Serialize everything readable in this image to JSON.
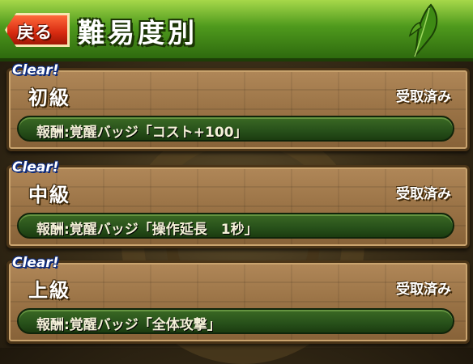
{
  "header": {
    "back_label": "戻る",
    "title": "難易度別"
  },
  "levels": [
    {
      "badge": "Clear!",
      "name": "初級",
      "status": "受取済み",
      "reward": "報酬:覚醒バッジ「コスト+100」"
    },
    {
      "badge": "Clear!",
      "name": "中級",
      "status": "受取済み",
      "reward": "報酬:覚醒バッジ「操作延長　1秒」"
    },
    {
      "badge": "Clear!",
      "name": "上級",
      "status": "受取済み",
      "reward": "報酬:覚醒バッジ「全体攻撃」"
    }
  ],
  "colors": {
    "header_green": "#4f9a1d",
    "back_red": "#d72a10",
    "panel_brown": "#9a7346",
    "reward_green": "#27501a",
    "clear_blue": "#0d2a7a"
  },
  "icons": {
    "back": "back-arrow-icon",
    "decoration": "leaf-icon"
  }
}
